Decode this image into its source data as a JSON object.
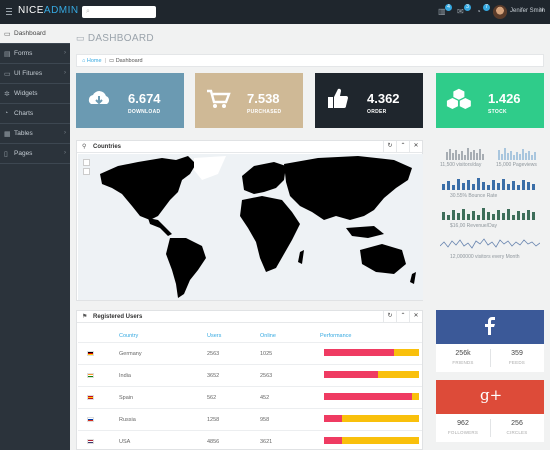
{
  "brand": {
    "left": "NICE",
    "right": "ADMIN"
  },
  "search": {
    "placeholder": ""
  },
  "topbar": {
    "badges": [
      "4",
      "3",
      "7"
    ],
    "user_name": "Jenifer Smith"
  },
  "sidebar": {
    "items": [
      {
        "label": "Dashboard",
        "icon": "laptop-icon",
        "active": true
      },
      {
        "label": "Forms",
        "icon": "document-icon"
      },
      {
        "label": "UI Fitures",
        "icon": "desktop-icon"
      },
      {
        "label": "Widgets",
        "icon": "gear-icon"
      },
      {
        "label": "Charts",
        "icon": "pie-chart-icon"
      },
      {
        "label": "Tables",
        "icon": "table-icon"
      },
      {
        "label": "Pages",
        "icon": "file-icon"
      }
    ]
  },
  "page": {
    "title": "DASHBOARD"
  },
  "breadcrumb": {
    "home": "Home",
    "current": "Dashboard"
  },
  "tiles": [
    {
      "value": "6.674",
      "label": "DOWNLOAD",
      "color": "#6b9ab2",
      "icon": "cloud-download-icon"
    },
    {
      "value": "7.538",
      "label": "PURCHASED",
      "color": "#cfb996",
      "icon": "shopping-cart-icon"
    },
    {
      "value": "4.362",
      "label": "ORDER",
      "color": "#1f262d",
      "icon": "thumbs-up-icon"
    },
    {
      "value": "1.426",
      "label": "STOCK",
      "color": "#2fcc8a",
      "icon": "cubes-icon"
    }
  ],
  "map_panel": {
    "title": "Countries"
  },
  "sparklines": [
    {
      "label": "11,500 visitors/day",
      "color": "#a7adb3"
    },
    {
      "label": "15,000 Pageviews",
      "color": "#a9c6de"
    },
    {
      "label": "30.55% Bounce Rate",
      "color": "#3a6ea8"
    },
    {
      "label": "$16,00 Revenue/Day",
      "color": "#3e6e5a"
    },
    {
      "label": "12,000000 visitors every Month",
      "color": "#6a86b0"
    }
  ],
  "users_panel": {
    "title": "Registered Users",
    "columns": [
      "Country",
      "Users",
      "Online",
      "Performance"
    ],
    "rows": [
      {
        "country": "Germany",
        "users": "2563",
        "online": "1025",
        "perf": 0.74,
        "flag": [
          "#000000",
          "#dd0000",
          "#ffce00"
        ]
      },
      {
        "country": "India",
        "users": "3652",
        "online": "2563",
        "perf": 0.57,
        "flag": [
          "#ff9933",
          "#ffffff",
          "#138808"
        ]
      },
      {
        "country": "Spain",
        "users": "562",
        "online": "452",
        "perf": 0.93,
        "flag": [
          "#c60b1e",
          "#ffc400",
          "#c60b1e"
        ]
      },
      {
        "country": "Russia",
        "users": "1258",
        "online": "958",
        "perf": 0.19,
        "flag": [
          "#ffffff",
          "#0039a6",
          "#d52b1e"
        ]
      },
      {
        "country": "USA",
        "users": "4856",
        "online": "3621",
        "perf": 0.19,
        "flag": [
          "#b22234",
          "#ffffff",
          "#3c3b6e"
        ]
      }
    ]
  },
  "facebook": {
    "glyph": "f",
    "color": "#3b5998",
    "stat1_value": "256k",
    "stat1_label": "FRIENDS",
    "stat2_value": "359",
    "stat2_label": "FEEDS"
  },
  "google": {
    "glyph": "g+",
    "color": "#dd4b39",
    "stat1_value": "962",
    "stat1_label": "FOLLOWERS",
    "stat2_value": "256",
    "stat2_label": "CIRCLES"
  }
}
